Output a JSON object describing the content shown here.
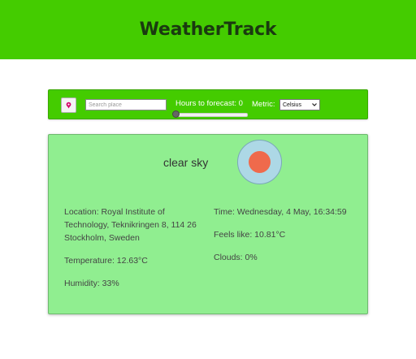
{
  "header": {
    "title": "WeatherTrack",
    "color": "#44cc00"
  },
  "toolbar": {
    "locate_icon": "location-pin-icon",
    "search_placeholder": "Search place",
    "search_value": "",
    "hours_label": "Hours to forecast:",
    "hours_value": "0",
    "metric_label": "Metric:",
    "metric_selected": "Celsius"
  },
  "weather": {
    "description": "clear sky",
    "icon": "sun-icon",
    "location": "Location: Royal Institute of Technology, Teknikringen 8, 114 26 Stockholm, Sweden",
    "temperature": "Temperature: 12.63°C",
    "humidity": "Humidity: 33%",
    "time": "Time: Wednesday, 4 May, 16:34:59",
    "feels_like": "Feels like: 10.81°C",
    "clouds": "Clouds: 0%",
    "card_color": "#90ee90"
  }
}
